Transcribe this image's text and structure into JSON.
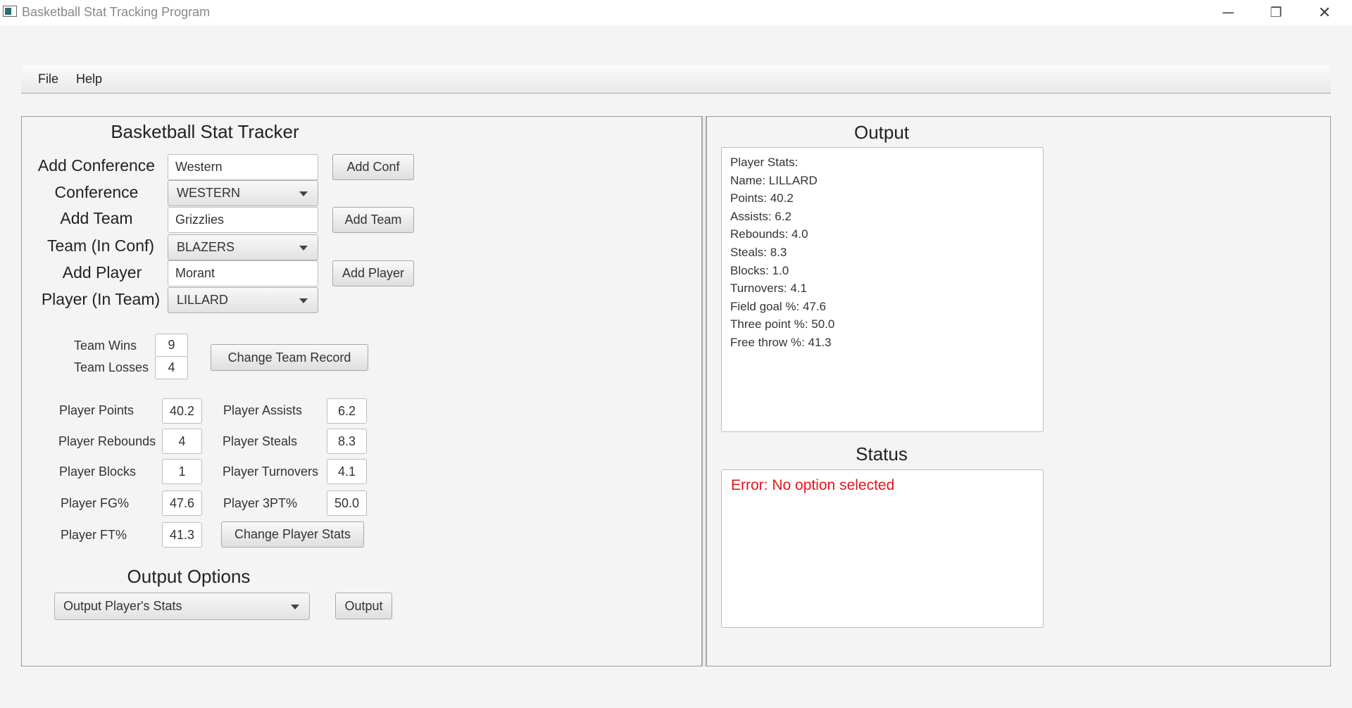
{
  "window": {
    "title": "Basketball Stat Tracking Program",
    "controls": [
      "─",
      "❐",
      "✕"
    ]
  },
  "menu": {
    "items": [
      "File",
      "Help"
    ]
  },
  "tracker": {
    "title": "Basketball Stat Tracker",
    "add_conference": {
      "label": "Add Conference",
      "value": "Western",
      "button": "Add Conf"
    },
    "conference": {
      "label": "Conference",
      "selected": "WESTERN"
    },
    "add_team": {
      "label": "Add Team",
      "value": "Grizzlies",
      "button": "Add Team"
    },
    "team_in_conf": {
      "label": "Team (In Conf)",
      "selected": "BLAZERS"
    },
    "add_player": {
      "label": "Add Player",
      "value": "Morant",
      "button": "Add Player"
    },
    "player_in_team": {
      "label": "Player (In Team)",
      "selected": "LILLARD"
    }
  },
  "record": {
    "wins_label": "Team Wins",
    "wins": "9",
    "losses_label": "Team Losses",
    "losses": "4",
    "button": "Change Team Record"
  },
  "player_stats": {
    "points_label": "Player Points",
    "points": "40.2",
    "assists_label": "Player Assists",
    "assists": "6.2",
    "rebounds_label": "Player Rebounds",
    "rebounds": "4",
    "steals_label": "Player Steals",
    "steals": "8.3",
    "blocks_label": "Player Blocks",
    "blocks": "1",
    "turnovers_label": "Player Turnovers",
    "turnovers": "4.1",
    "fg_label": "Player FG%",
    "fg": "47.6",
    "three_label": "Player 3PT%",
    "three": "50.0",
    "ft_label": "Player FT%",
    "ft": "41.3",
    "button": "Change Player Stats"
  },
  "output_options": {
    "title": "Output Options",
    "selected": "Output Player's Stats",
    "button": "Output"
  },
  "output": {
    "title": "Output",
    "lines": [
      "Player Stats:",
      "Name: LILLARD",
      "Points: 40.2",
      "Assists: 6.2",
      "Rebounds: 4.0",
      "Steals: 8.3",
      "Blocks: 1.0",
      "Turnovers: 4.1",
      "Field goal %: 47.6",
      "Three point %: 50.0",
      "Free throw %: 41.3"
    ]
  },
  "status": {
    "title": "Status",
    "message": "Error: No option selected",
    "message_color": "#e8141a"
  }
}
